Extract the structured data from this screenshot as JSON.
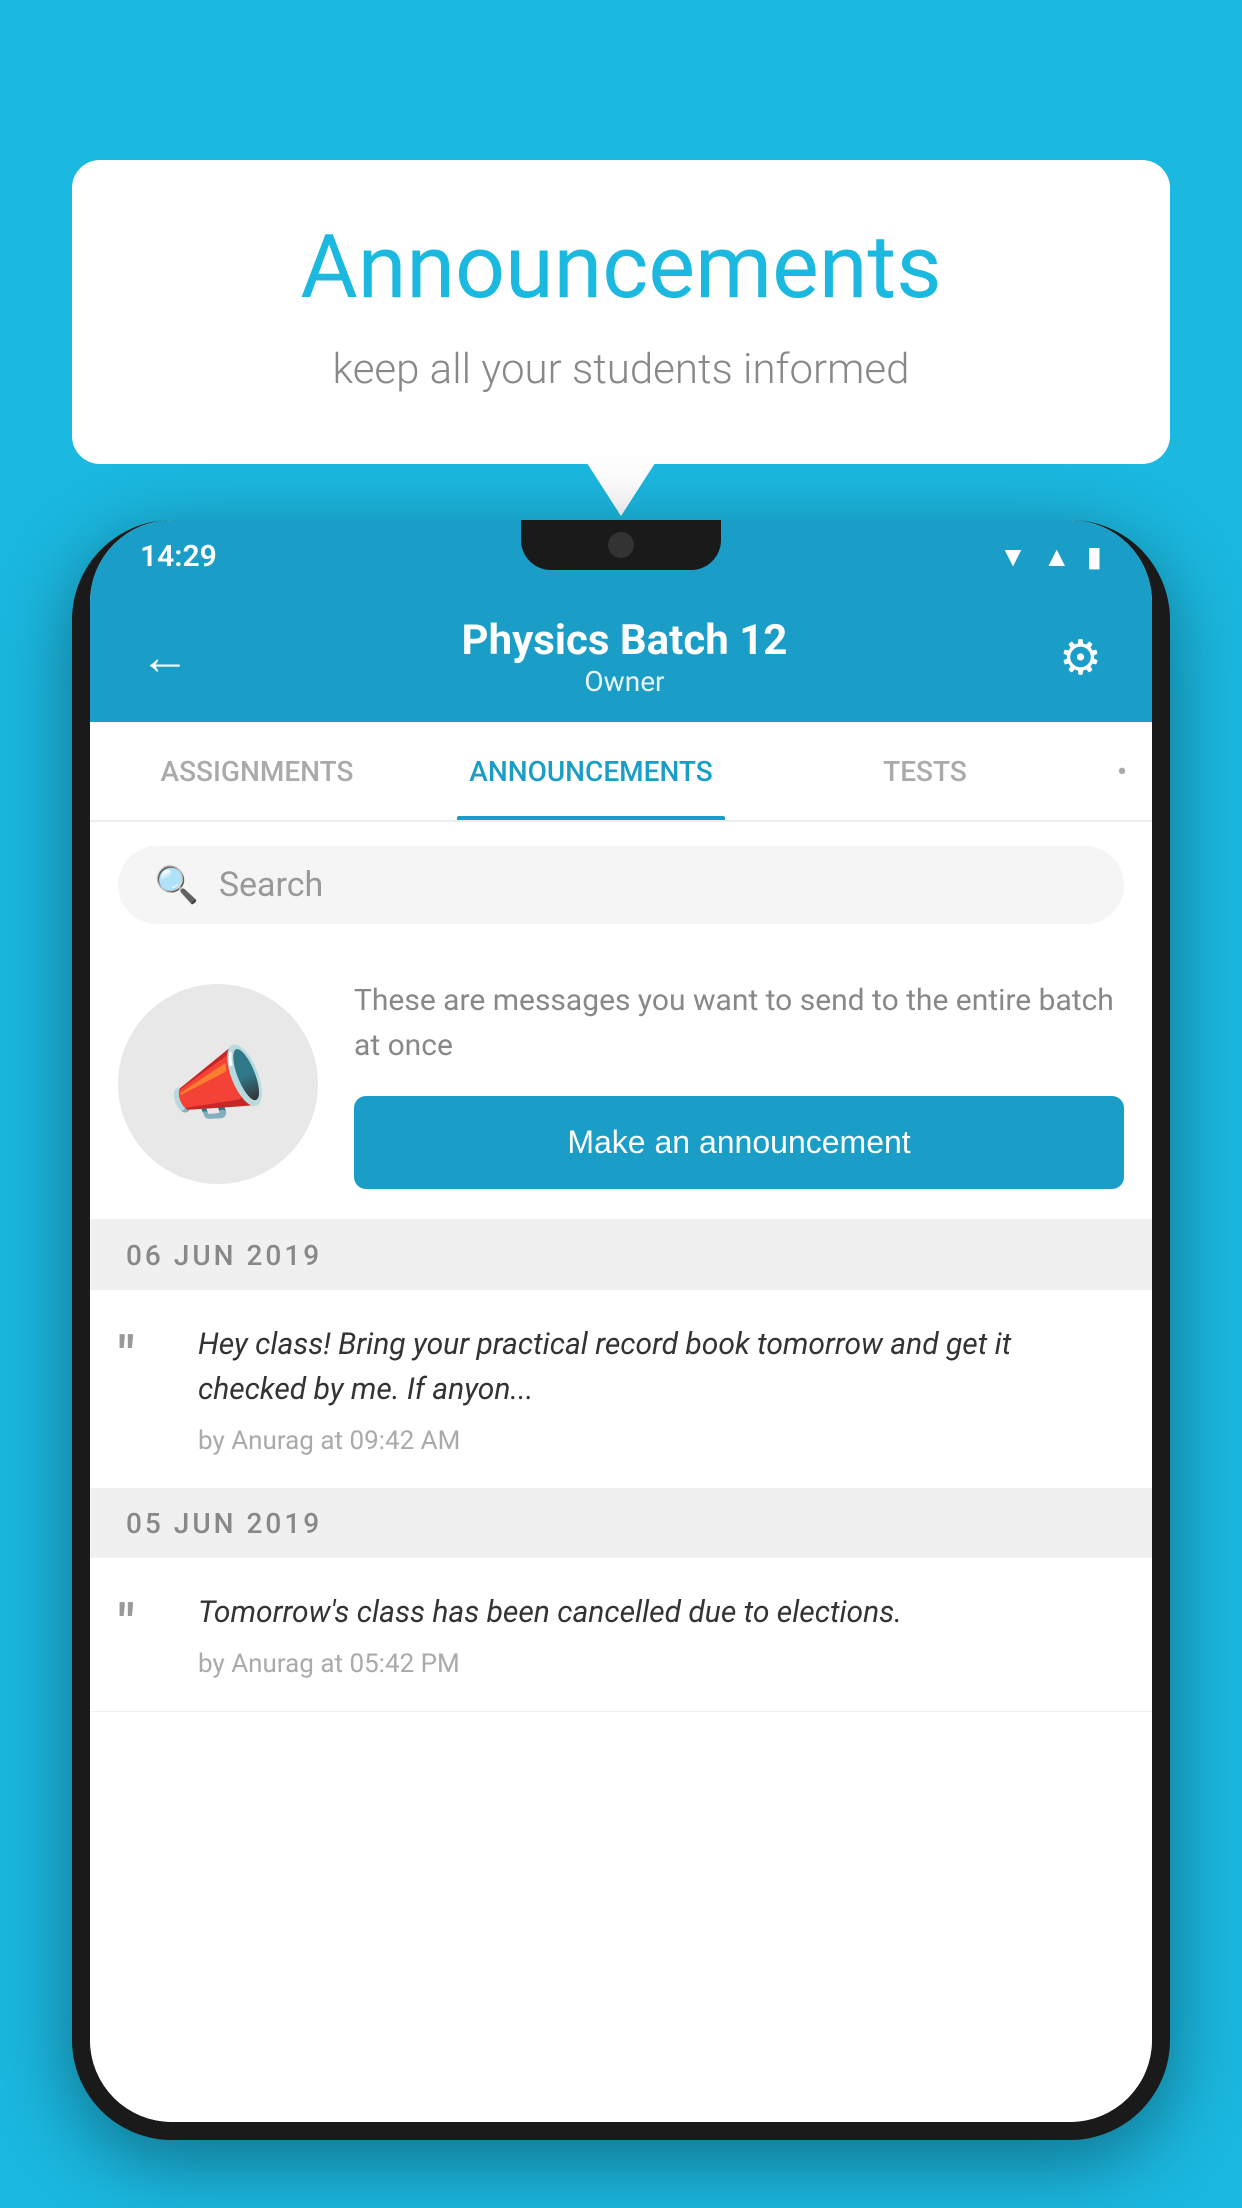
{
  "page": {
    "background_color": "#1bb8e0"
  },
  "speech_bubble": {
    "title": "Announcements",
    "subtitle": "keep all your students informed"
  },
  "status_bar": {
    "time": "14:29",
    "icons": [
      "wifi",
      "signal",
      "battery"
    ]
  },
  "header": {
    "title": "Physics Batch 12",
    "subtitle": "Owner",
    "back_label": "←",
    "gear_label": "⚙"
  },
  "tabs": [
    {
      "label": "ASSIGNMENTS",
      "active": false
    },
    {
      "label": "ANNOUNCEMENTS",
      "active": true
    },
    {
      "label": "TESTS",
      "active": false
    },
    {
      "label": "•",
      "active": false
    }
  ],
  "search": {
    "placeholder": "Search"
  },
  "promo": {
    "description": "These are messages you want to send to the entire batch at once",
    "button_label": "Make an announcement"
  },
  "announcements": [
    {
      "date": "06  JUN  2019",
      "text": "Hey class! Bring your practical record book tomorrow and get it checked by me. If anyon...",
      "meta": "by Anurag at 09:42 AM"
    },
    {
      "date": "05  JUN  2019",
      "text": "Tomorrow's class has been cancelled due to elections.",
      "meta": "by Anurag at 05:42 PM"
    }
  ]
}
